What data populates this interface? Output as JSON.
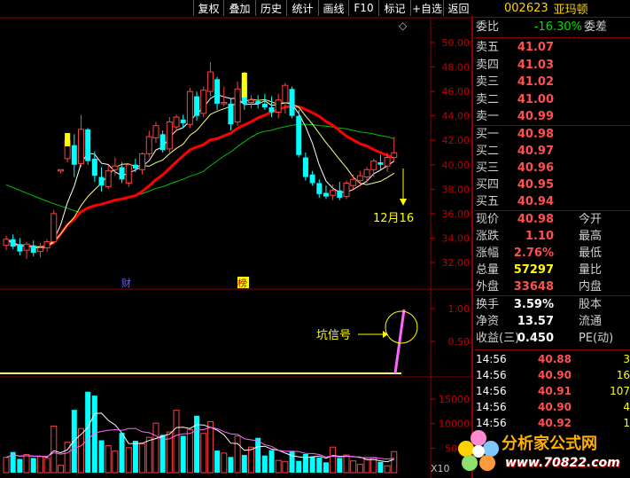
{
  "toolbar": {
    "items": [
      "复权",
      "叠加",
      "历史",
      "统计",
      "画线",
      "F10",
      "标记",
      "+自选",
      "返回"
    ]
  },
  "stock": {
    "code": "002623",
    "name": "亚玛顿"
  },
  "order_book": {
    "ratio_label": "委比",
    "ratio_value": "-16.30%",
    "diff_label": "委差",
    "asks": [
      {
        "label": "卖五",
        "price": "41.07"
      },
      {
        "label": "卖四",
        "price": "41.03"
      },
      {
        "label": "卖三",
        "price": "41.02"
      },
      {
        "label": "卖二",
        "price": "41.00"
      },
      {
        "label": "卖一",
        "price": "40.99"
      }
    ],
    "bids": [
      {
        "label": "买一",
        "price": "40.98"
      },
      {
        "label": "买二",
        "price": "40.97"
      },
      {
        "label": "买三",
        "price": "40.96"
      },
      {
        "label": "买四",
        "price": "40.95"
      },
      {
        "label": "买五",
        "price": "40.94"
      }
    ]
  },
  "quote": [
    {
      "label": "现价",
      "value": "40.98",
      "label2": "今开"
    },
    {
      "label": "涨跌",
      "value": "1.10",
      "label2": "最高"
    },
    {
      "label": "涨幅",
      "value": "2.76%",
      "label2": "最低"
    },
    {
      "label": "总量",
      "value": "57297",
      "label2": "量比"
    },
    {
      "label": "外盘",
      "value": "33648",
      "label2": "内盘"
    }
  ],
  "stats": [
    {
      "label": "换手",
      "value": "3.59%",
      "label2": "股本"
    },
    {
      "label": "净资",
      "value": "13.57",
      "label2": "流通"
    },
    {
      "label": "收益(三)",
      "value": "0.450",
      "label2": "PE(动)"
    }
  ],
  "ticks": [
    {
      "time": "14:56",
      "price": "40.88",
      "vol": "3"
    },
    {
      "time": "14:56",
      "price": "40.90",
      "vol": "16"
    },
    {
      "time": "14:56",
      "price": "40.91",
      "vol": "107"
    },
    {
      "time": "14:56",
      "price": "40.90",
      "vol": "4"
    },
    {
      "time": "14:56",
      "price": "40.92",
      "vol": "1"
    }
  ],
  "chart": {
    "price_axis": [
      "50.00",
      "48.00",
      "46.00",
      "44.00",
      "42.00",
      "40.00",
      "38.00",
      "36.00",
      "34.00",
      "32.00"
    ],
    "signal_axis": [
      "1.00",
      "0.50"
    ],
    "volume_axis": [
      "15000",
      "10000",
      "5000"
    ],
    "volume_unit": "X10",
    "annotation_date": "12月16",
    "annotation_signal": "坑信号",
    "event_markers": [
      "财",
      "榜"
    ],
    "diamond": "◇"
  },
  "watermark": {
    "brand": "分析家公式网",
    "url": "www.70822.com"
  },
  "colors": {
    "up": "#ff4040",
    "down": "#00ffff",
    "ma_red": "#ff0000",
    "ma_green": "#00c000",
    "ma_yellow": "#ffff80",
    "ma_white": "#ffffff"
  },
  "chart_data": {
    "type": "candlestick",
    "y_range": [
      31,
      51
    ],
    "candles": [
      {
        "o": 33.4,
        "h": 34.2,
        "l": 33.0,
        "c": 33.9
      },
      {
        "o": 33.9,
        "h": 34.3,
        "l": 33.1,
        "c": 33.3
      },
      {
        "o": 33.5,
        "h": 34.0,
        "l": 32.6,
        "c": 32.9
      },
      {
        "o": 33.0,
        "h": 33.7,
        "l": 32.3,
        "c": 33.5
      },
      {
        "o": 33.4,
        "h": 33.8,
        "l": 32.5,
        "c": 32.8
      },
      {
        "o": 32.9,
        "h": 33.6,
        "l": 32.4,
        "c": 33.2
      },
      {
        "o": 33.2,
        "h": 33.9,
        "l": 32.9,
        "c": 33.7
      },
      {
        "o": 33.7,
        "h": 36.3,
        "l": 33.5,
        "c": 36.0
      },
      {
        "o": 39.6,
        "h": 39.6,
        "l": 39.3,
        "c": 39.6
      },
      {
        "o": 40.5,
        "h": 42.2,
        "l": 40.2,
        "c": 42.0
      },
      {
        "o": 41.6,
        "h": 42.5,
        "l": 39.0,
        "c": 40.0
      },
      {
        "o": 40.1,
        "h": 44.1,
        "l": 39.8,
        "c": 42.9
      },
      {
        "o": 42.9,
        "h": 43.0,
        "l": 40.0,
        "c": 40.3
      },
      {
        "o": 40.5,
        "h": 41.1,
        "l": 38.6,
        "c": 39.1
      },
      {
        "o": 39.0,
        "h": 39.8,
        "l": 37.8,
        "c": 38.3
      },
      {
        "o": 38.2,
        "h": 40.0,
        "l": 38.0,
        "c": 39.5
      },
      {
        "o": 39.6,
        "h": 40.6,
        "l": 39.1,
        "c": 39.9
      },
      {
        "o": 39.8,
        "h": 40.2,
        "l": 38.5,
        "c": 38.8
      },
      {
        "o": 38.5,
        "h": 40.1,
        "l": 38.2,
        "c": 40.0
      },
      {
        "o": 40.0,
        "h": 40.5,
        "l": 39.4,
        "c": 39.7
      },
      {
        "o": 39.6,
        "h": 41.0,
        "l": 39.2,
        "c": 40.9
      },
      {
        "o": 40.9,
        "h": 42.8,
        "l": 40.6,
        "c": 42.3
      },
      {
        "o": 42.2,
        "h": 43.5,
        "l": 41.8,
        "c": 43.2
      },
      {
        "o": 42.5,
        "h": 42.8,
        "l": 41.0,
        "c": 41.2
      },
      {
        "o": 41.3,
        "h": 43.9,
        "l": 41.0,
        "c": 43.5
      },
      {
        "o": 43.1,
        "h": 44.1,
        "l": 42.7,
        "c": 43.9
      },
      {
        "o": 43.7,
        "h": 44.1,
        "l": 43.0,
        "c": 43.4
      },
      {
        "o": 43.3,
        "h": 46.3,
        "l": 43.0,
        "c": 46.0
      },
      {
        "o": 45.6,
        "h": 46.0,
        "l": 43.6,
        "c": 44.0
      },
      {
        "o": 44.2,
        "h": 46.4,
        "l": 43.9,
        "c": 46.1
      },
      {
        "o": 46.0,
        "h": 48.4,
        "l": 45.6,
        "c": 47.6
      },
      {
        "o": 47.0,
        "h": 47.2,
        "l": 44.5,
        "c": 45.0
      },
      {
        "o": 45.1,
        "h": 46.4,
        "l": 44.8,
        "c": 45.1
      },
      {
        "o": 45.0,
        "h": 45.4,
        "l": 42.8,
        "c": 43.3
      },
      {
        "o": 43.5,
        "h": 46.8,
        "l": 43.2,
        "c": 46.2
      },
      {
        "o": 46.7,
        "h": 47.6,
        "l": 44.5,
        "c": 45.0
      },
      {
        "o": 45.1,
        "h": 45.7,
        "l": 44.6,
        "c": 45.3
      },
      {
        "o": 45.2,
        "h": 45.7,
        "l": 44.6,
        "c": 45.0
      },
      {
        "o": 45.0,
        "h": 45.8,
        "l": 44.5,
        "c": 44.7
      },
      {
        "o": 44.7,
        "h": 45.6,
        "l": 43.9,
        "c": 44.3
      },
      {
        "o": 44.3,
        "h": 45.8,
        "l": 43.8,
        "c": 45.3
      },
      {
        "o": 45.1,
        "h": 46.7,
        "l": 44.2,
        "c": 46.5
      },
      {
        "o": 46.2,
        "h": 46.4,
        "l": 43.8,
        "c": 44.0
      },
      {
        "o": 44.0,
        "h": 44.5,
        "l": 40.6,
        "c": 40.8
      },
      {
        "o": 40.6,
        "h": 41.0,
        "l": 38.7,
        "c": 39.0
      },
      {
        "o": 39.2,
        "h": 39.5,
        "l": 38.3,
        "c": 38.5
      },
      {
        "o": 38.5,
        "h": 38.8,
        "l": 37.3,
        "c": 37.6
      },
      {
        "o": 37.7,
        "h": 38.3,
        "l": 37.2,
        "c": 37.4
      },
      {
        "o": 37.5,
        "h": 38.4,
        "l": 37.1,
        "c": 37.9
      },
      {
        "o": 37.9,
        "h": 38.6,
        "l": 37.1,
        "c": 37.3
      },
      {
        "o": 37.4,
        "h": 38.7,
        "l": 37.2,
        "c": 38.5
      },
      {
        "o": 38.3,
        "h": 39.2,
        "l": 38.0,
        "c": 38.8
      },
      {
        "o": 38.7,
        "h": 39.5,
        "l": 38.2,
        "c": 39.1
      },
      {
        "o": 39.0,
        "h": 39.8,
        "l": 38.5,
        "c": 39.6
      },
      {
        "o": 39.6,
        "h": 40.5,
        "l": 39.0,
        "c": 40.3
      },
      {
        "o": 40.2,
        "h": 40.8,
        "l": 39.6,
        "c": 40.0
      },
      {
        "o": 39.9,
        "h": 41.0,
        "l": 39.4,
        "c": 40.6
      },
      {
        "o": 40.6,
        "h": 42.3,
        "l": 40.3,
        "c": 40.98
      }
    ],
    "volumes": [
      3100,
      4200,
      2800,
      3700,
      3000,
      3300,
      2900,
      9500,
      1500,
      6200,
      12800,
      9000,
      16500,
      15700,
      6600,
      5500,
      4400,
      8100,
      5100,
      6500,
      5900,
      7200,
      10100,
      7700,
      8300,
      12700,
      7500,
      8800,
      11600,
      8000,
      10400,
      4500,
      4000,
      3200,
      7500,
      3600,
      5200,
      7100,
      3500,
      4600,
      2500,
      2300,
      4400,
      2400,
      3800,
      3300,
      3100,
      2100,
      5200,
      3000,
      3600,
      2400,
      1700,
      2700,
      3100,
      2200,
      1400,
      4300
    ]
  }
}
